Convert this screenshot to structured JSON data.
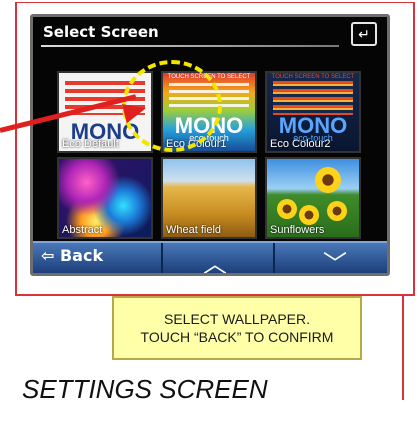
{
  "screen": {
    "title": "Select Screen",
    "wallpapers": [
      {
        "label": "Eco Default",
        "overlay": "MONO"
      },
      {
        "label": "Eco Colour1",
        "overlay": "MONO",
        "sub": "eco-touch",
        "banner": "TOUCH SCREEN TO SELECT"
      },
      {
        "label": "Eco Colour2",
        "overlay": "MONO",
        "sub": "eco-touch",
        "banner": "TOUCH SCREEN TO SELECT"
      },
      {
        "label": "Abstract"
      },
      {
        "label": "Wheat field"
      },
      {
        "label": "Sunflowers"
      }
    ],
    "nav": {
      "back_label": "Back"
    }
  },
  "annotation": {
    "note_line1": "SELECT WALLPAPER.",
    "note_line2": "TOUCH “BACK” TO CONFIRM",
    "caption": "SETTINGS SCREEN"
  },
  "colors": {
    "annotation_red": "#e01f1f",
    "highlight": "#f2e600",
    "note_bg": "#ffffa8",
    "nav_blue": "#2a5aa0"
  },
  "icons": [
    "return-icon",
    "back-arrow-icon",
    "up-chevron-icon",
    "down-chevron-icon"
  ]
}
